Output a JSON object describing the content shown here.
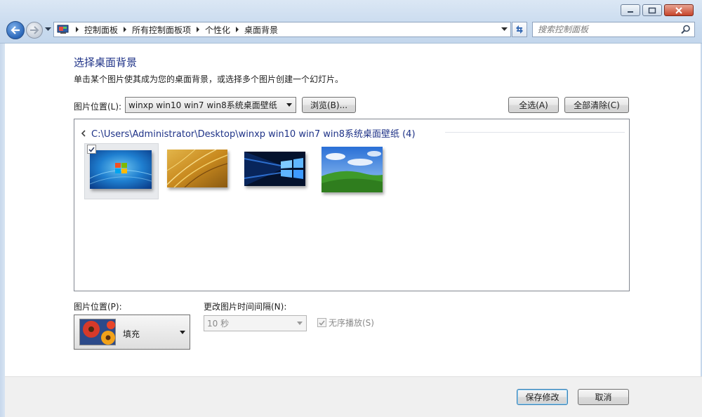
{
  "window": {
    "minimize_label": "",
    "maximize_label": "",
    "close_label": ""
  },
  "address": {
    "crumbs": [
      "控制面板",
      "所有控制面板项",
      "个性化",
      "桌面背景"
    ]
  },
  "search": {
    "placeholder": "搜索控制面板"
  },
  "content": {
    "title": "选择桌面背景",
    "description": "单击某个图片使其成为您的桌面背景，或选择多个图片创建一个幻灯片。",
    "location_label": "图片位置(L):",
    "location_value": "winxp win10 win7 win8系统桌面壁纸",
    "browse_button": "浏览(B)...",
    "select_all_button": "全选(A)",
    "clear_all_button": "全部清除(C)",
    "group_header": "C:\\Users\\Administrator\\Desktop\\winxp win10 win7 win8系统桌面壁纸 (4)",
    "thumbnails": [
      {
        "name": "win7",
        "checked": true
      },
      {
        "name": "grass",
        "checked": false
      },
      {
        "name": "win10",
        "checked": false
      },
      {
        "name": "bliss",
        "checked": false
      }
    ],
    "position_label": "图片位置(P):",
    "position_value": "填充",
    "interval_label": "更改图片时间间隔(N):",
    "interval_value": "10 秒",
    "shuffle_label": "无序播放(S)",
    "shuffle_checked": true
  },
  "footer": {
    "save_button": "保存修改",
    "cancel_button": "取消"
  },
  "colors": {
    "title_blue": "#1e3287",
    "frame": "#c9dbef"
  }
}
